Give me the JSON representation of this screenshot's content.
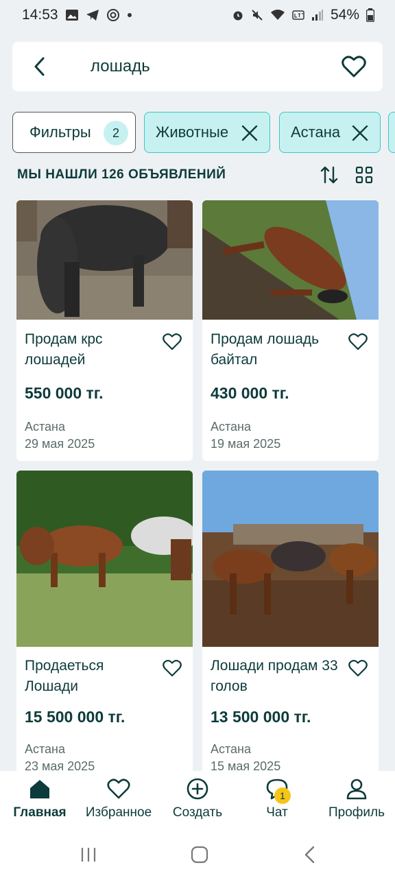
{
  "status_bar": {
    "time": "14:53",
    "battery": "54%"
  },
  "search": {
    "query": "лошадь"
  },
  "chips": {
    "filters_label": "Фильтры",
    "filters_count": "2",
    "category": "Животные",
    "city": "Астана"
  },
  "results": {
    "title": "МЫ НАШЛИ 126 ОБЪЯВЛЕНИЙ"
  },
  "listings": [
    {
      "title": "Продам крс лошадей",
      "price": "550 000 тг.",
      "city": "Астана",
      "date": "29 мая 2025"
    },
    {
      "title": "Продам лошадь байтал",
      "price": "430 000 тг.",
      "city": "Астана",
      "date": "19 мая 2025"
    },
    {
      "title": "Продаеться Лошади",
      "price": "15 500 000 тг.",
      "city": "Астана",
      "date": "23 мая 2025"
    },
    {
      "title": "Лошади продам 33 голов",
      "price": "13 500 000 тг.",
      "city": "Астана",
      "date": "15 мая 2025"
    }
  ],
  "bottom_nav": {
    "items": [
      {
        "label": "Главная",
        "icon": "home-icon"
      },
      {
        "label": "Избранное",
        "icon": "heart-icon"
      },
      {
        "label": "Создать",
        "icon": "plus-circle-icon"
      },
      {
        "label": "Чат",
        "icon": "chat-icon",
        "badge": "1"
      },
      {
        "label": "Профиль",
        "icon": "profile-icon"
      }
    ]
  },
  "colors": {
    "accent": "#39c6c6",
    "chip_bg": "#c7f1f1",
    "text": "#0d3a3a",
    "badge": "#f5c518"
  }
}
